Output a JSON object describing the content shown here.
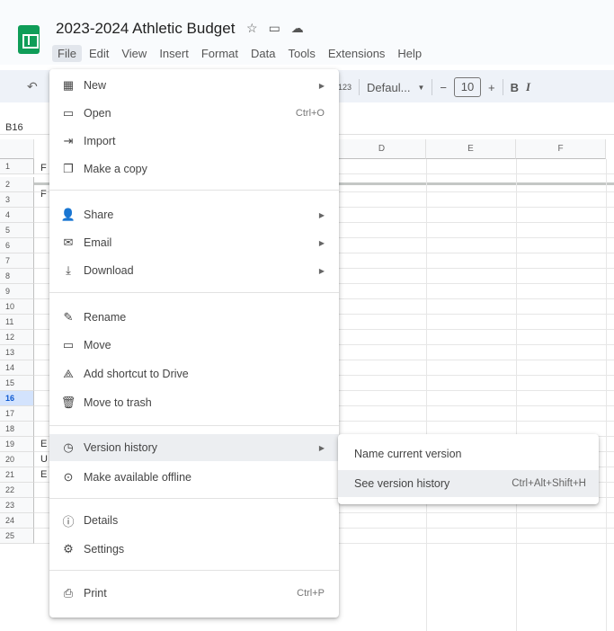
{
  "app": {
    "title": "2023-2024 Athletic Budget",
    "title_icons": [
      "star-icon",
      "folder-move-icon",
      "cloud-status-icon"
    ]
  },
  "menubar": [
    "File",
    "Edit",
    "View",
    "Insert",
    "Format",
    "Data",
    "Tools",
    "Extensions",
    "Help"
  ],
  "toolbar": {
    "format_123": "123",
    "font_family": "Defaul...",
    "font_size": "10",
    "bold": "B",
    "italic": "I"
  },
  "cell_reference": "B16",
  "columns": [
    "D",
    "E",
    "F"
  ],
  "rows": [
    "1",
    "2",
    "3",
    "4",
    "5",
    "6",
    "7",
    "8",
    "9",
    "10",
    "11",
    "12",
    "13",
    "14",
    "15",
    "16",
    "17",
    "18",
    "19",
    "20",
    "21",
    "22",
    "23",
    "24",
    "25"
  ],
  "cell_peeks": {
    "r1": "F",
    "r2": "F",
    "r15": "E",
    "r16": "U",
    "r17": "E"
  },
  "file_menu": {
    "items": [
      {
        "label": "New",
        "icon": "sheet-new-icon",
        "arrow": true
      },
      {
        "label": "Open",
        "icon": "folder-open-icon",
        "shortcut": "Ctrl+O"
      },
      {
        "label": "Import",
        "icon": "import-icon"
      },
      {
        "label": "Make a copy",
        "icon": "copy-icon"
      },
      {
        "label": "Share",
        "icon": "share-person-icon",
        "arrow": true
      },
      {
        "label": "Email",
        "icon": "email-icon",
        "arrow": true
      },
      {
        "label": "Download",
        "icon": "download-icon",
        "arrow": true
      },
      {
        "label": "Rename",
        "icon": "rename-icon"
      },
      {
        "label": "Move",
        "icon": "move-folder-icon"
      },
      {
        "label": "Add shortcut to Drive",
        "icon": "drive-shortcut-icon"
      },
      {
        "label": "Move to trash",
        "icon": "trash-icon"
      },
      {
        "label": "Version history",
        "icon": "history-icon",
        "arrow": true,
        "highlighted": true
      },
      {
        "label": "Make available offline",
        "icon": "offline-icon"
      },
      {
        "label": "Details",
        "icon": "info-icon"
      },
      {
        "label": "Settings",
        "icon": "gear-icon"
      },
      {
        "label": "Print",
        "icon": "print-icon",
        "shortcut": "Ctrl+P"
      }
    ]
  },
  "version_submenu": {
    "items": [
      {
        "label": "Name current version"
      },
      {
        "label": "See version history",
        "shortcut": "Ctrl+Alt+Shift+H",
        "highlighted": true
      }
    ]
  },
  "colors": {
    "sheets_green": "#0f9d58",
    "selected_row": "#d3e3fd",
    "menu_highlight": "#eceef1"
  }
}
